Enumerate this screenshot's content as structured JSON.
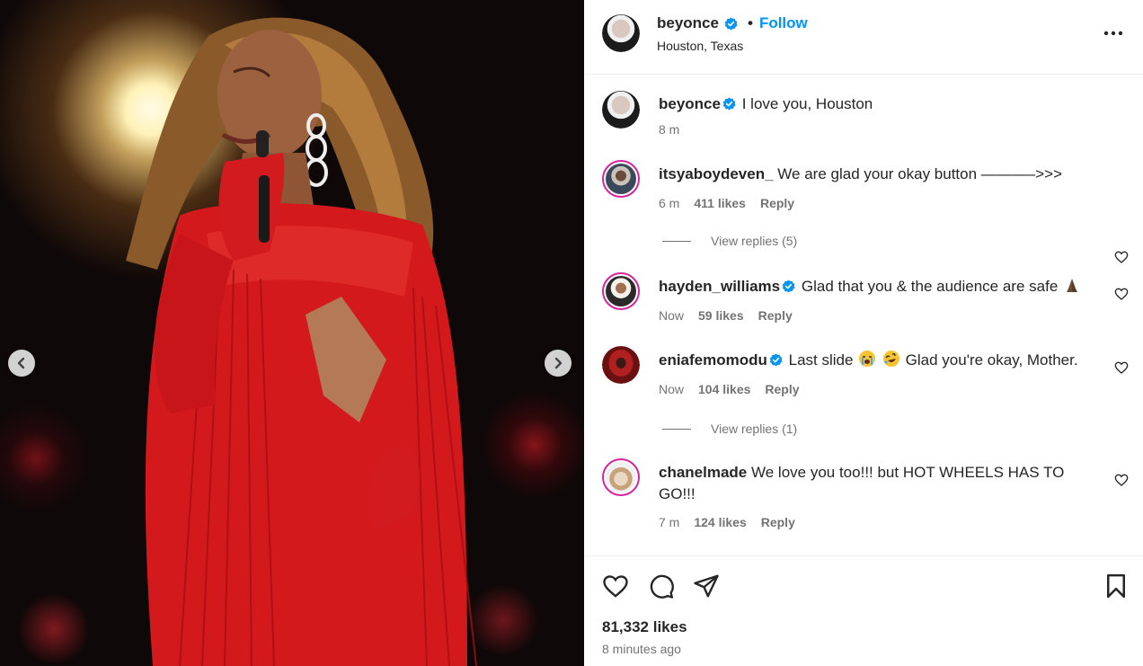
{
  "post": {
    "username": "beyonce",
    "follow_label": "Follow",
    "separator": "•",
    "location": "Houston, Texas",
    "caption": {
      "username": "beyonce",
      "text": "I love you, Houston",
      "time": "8 m"
    },
    "like_count": "81,332 likes",
    "posted_ago": "8 minutes ago"
  },
  "comments": [
    {
      "username": "itsyaboydeven_",
      "verified": false,
      "text": "We are glad your okay button ———–>>>",
      "time": "6 m",
      "likes": "411 likes",
      "reply_label": "Reply",
      "view_replies": "View replies (5)"
    },
    {
      "username": "hayden_williams",
      "verified": true,
      "text": "Glad that you & the audience are safe",
      "emoji": [
        "folded-hands"
      ],
      "time": "Now",
      "likes": "59 likes",
      "reply_label": "Reply"
    },
    {
      "username": "eniafemomodu",
      "verified": true,
      "text_before": "Last slide",
      "emoji": [
        "loudly-crying-face",
        "rolling-on-floor-laughing"
      ],
      "text_after": "Glad you're okay, Mother.",
      "time": "Now",
      "likes": "104 likes",
      "reply_label": "Reply",
      "view_replies": "View replies (1)"
    },
    {
      "username": "chanelmade",
      "verified": false,
      "text": "We love you too!!! but HOT WHEELS HAS TO GO!!!",
      "time": "7 m",
      "likes": "124 likes",
      "reply_label": "Reply"
    }
  ],
  "icons": {
    "verified": "verified-badge-icon",
    "more": "more-options-icon",
    "like": "heart-icon",
    "comment": "comment-bubble-icon",
    "share": "share-paper-plane-icon",
    "save": "bookmark-icon",
    "prev": "chevron-left-icon",
    "next": "chevron-right-icon"
  },
  "colors": {
    "accent": "#0095f6",
    "text": "#262626",
    "muted": "#737373",
    "divider": "#efefef",
    "dress": "#d4191c"
  }
}
